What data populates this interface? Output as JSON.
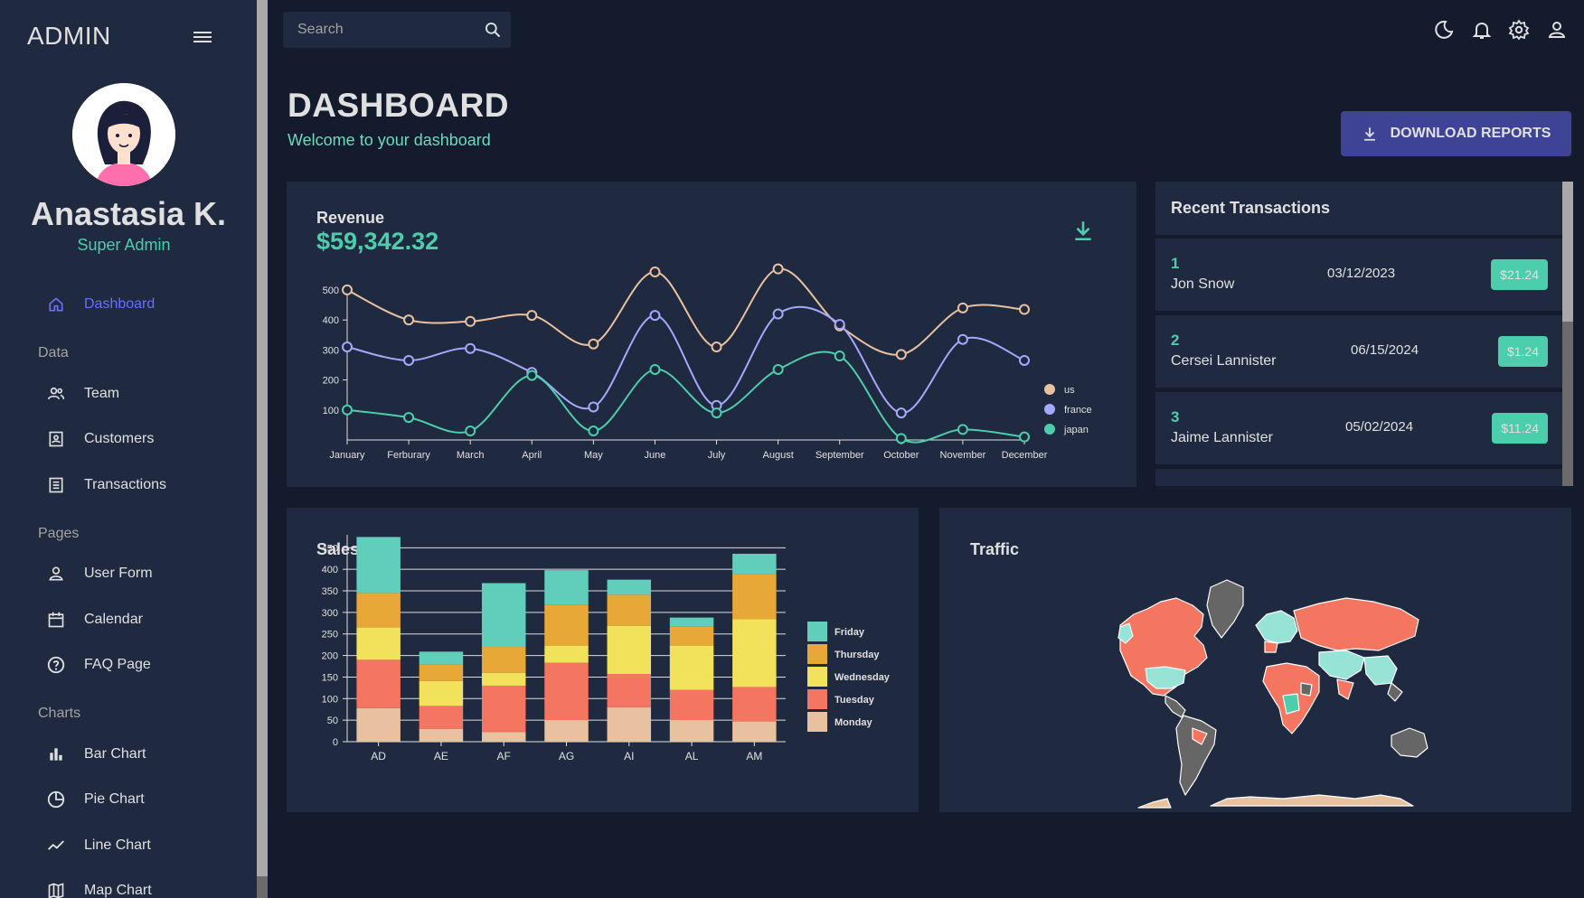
{
  "sidebar": {
    "brand": "ADMIN",
    "user_name": "Anastasia K.",
    "user_role": "Super Admin",
    "items": [
      {
        "label": "Dashboard",
        "icon": "home-icon",
        "active": true
      },
      {
        "label": "Team",
        "icon": "people-icon"
      },
      {
        "label": "Customers",
        "icon": "contacts-icon"
      },
      {
        "label": "Transactions",
        "icon": "receipt-icon"
      },
      {
        "label": "User Form",
        "icon": "person-icon"
      },
      {
        "label": "Calendar",
        "icon": "calendar-icon"
      },
      {
        "label": "FAQ Page",
        "icon": "help-icon"
      },
      {
        "label": "Bar Chart",
        "icon": "bar-chart-icon"
      },
      {
        "label": "Pie Chart",
        "icon": "pie-chart-icon"
      },
      {
        "label": "Line Chart",
        "icon": "timeline-icon"
      },
      {
        "label": "Map Chart",
        "icon": "map-icon"
      }
    ],
    "sections": [
      "Data",
      "Pages",
      "Charts"
    ]
  },
  "topbar": {
    "search_placeholder": "Search",
    "icons": [
      "dark-mode-icon",
      "notifications-icon",
      "settings-icon",
      "profile-icon"
    ]
  },
  "header": {
    "title": "DASHBOARD",
    "subtitle": "Welcome to your dashboard",
    "download_label": "DOWNLOAD REPORTS"
  },
  "revenue": {
    "title": "Revenue",
    "value": "$59,342.32"
  },
  "transactions": {
    "title": "Recent Transactions",
    "rows": [
      {
        "id": "1",
        "user": "Jon Snow",
        "date": "03/12/2023",
        "cost": "$21.24"
      },
      {
        "id": "2",
        "user": "Cersei Lannister",
        "date": "06/15/2024",
        "cost": "$1.24"
      },
      {
        "id": "3",
        "user": "Jaime Lannister",
        "date": "05/02/2024",
        "cost": "$11.24"
      }
    ]
  },
  "sales": {
    "title": "Sales"
  },
  "traffic": {
    "title": "Traffic"
  },
  "colors": {
    "accent_green": "#4cceac",
    "accent_blue": "#6870fa",
    "button": "#3e4396",
    "card": "#1f2a40",
    "background": "#141b2d"
  },
  "chart_data": [
    {
      "type": "line",
      "title": "Revenue",
      "x": [
        "January",
        "Ferburary",
        "March",
        "April",
        "May",
        "June",
        "July",
        "August",
        "September",
        "October",
        "November",
        "December"
      ],
      "yticks": [
        100,
        200,
        300,
        400,
        500
      ],
      "ylim": [
        0,
        560
      ],
      "legend": "right",
      "series": [
        {
          "name": "us",
          "color": "#e8c1a0",
          "values": [
            500,
            400,
            395,
            415,
            320,
            560,
            310,
            570,
            380,
            285,
            440,
            435
          ]
        },
        {
          "name": "france",
          "color": "#a4a9fc",
          "values": [
            310,
            265,
            305,
            225,
            110,
            415,
            115,
            420,
            385,
            90,
            335,
            265
          ]
        },
        {
          "name": "japan",
          "color": "#4cceac",
          "values": [
            100,
            75,
            30,
            215,
            30,
            235,
            90,
            235,
            280,
            5,
            35,
            10
          ]
        }
      ]
    },
    {
      "type": "bar",
      "title": "Sales",
      "categories": [
        "AD",
        "AE",
        "AF",
        "AG",
        "AI",
        "AL",
        "AM"
      ],
      "yticks": [
        0,
        50,
        100,
        150,
        200,
        250,
        300,
        350,
        400,
        450
      ],
      "ylim": [
        0,
        480
      ],
      "stacked": true,
      "legend": "right",
      "series": [
        {
          "name": "Monday",
          "color": "#e8c1a0",
          "values": [
            78,
            30,
            22,
            50,
            80,
            50,
            47
          ]
        },
        {
          "name": "Tuesday",
          "color": "#f47560",
          "values": [
            112,
            53,
            108,
            133,
            77,
            70,
            80
          ]
        },
        {
          "name": "Wednesday",
          "color": "#f1e15b",
          "values": [
            75,
            58,
            30,
            40,
            112,
            103,
            157
          ]
        },
        {
          "name": "Thursday",
          "color": "#e8a838",
          "values": [
            80,
            38,
            60,
            95,
            72,
            45,
            105
          ]
        },
        {
          "name": "Friday",
          "color": "#61cdbb",
          "values": [
            130,
            30,
            148,
            80,
            35,
            20,
            47
          ]
        }
      ]
    }
  ]
}
